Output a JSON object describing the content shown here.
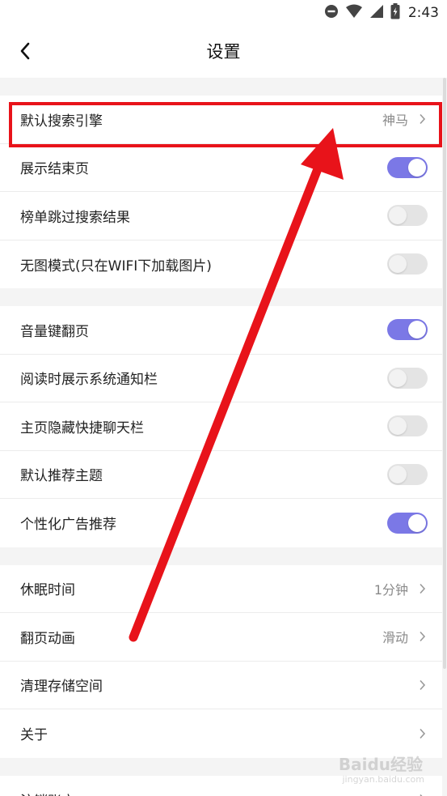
{
  "status_bar": {
    "time": "2:43",
    "icons": [
      "dnd-icon",
      "wifi-icon",
      "signal-icon",
      "battery-icon"
    ]
  },
  "app_bar": {
    "title": "设置",
    "back_icon": "chevron-left-icon"
  },
  "groups": [
    {
      "rows": [
        {
          "label": "默认搜索引擎",
          "type": "value",
          "value": "神马"
        },
        {
          "label": "展示结束页",
          "type": "toggle",
          "on": true
        },
        {
          "label": "榜单跳过搜索结果",
          "type": "toggle",
          "on": false
        },
        {
          "label": "无图模式(只在WIFI下加载图片)",
          "type": "toggle",
          "on": false
        }
      ]
    },
    {
      "rows": [
        {
          "label": "音量键翻页",
          "type": "toggle",
          "on": true
        },
        {
          "label": "阅读时展示系统通知栏",
          "type": "toggle",
          "on": false
        },
        {
          "label": "主页隐藏快捷聊天栏",
          "type": "toggle",
          "on": false
        },
        {
          "label": "默认推荐主题",
          "type": "toggle",
          "on": false
        },
        {
          "label": "个性化广告推荐",
          "type": "toggle",
          "on": true
        }
      ]
    },
    {
      "rows": [
        {
          "label": "休眠时间",
          "type": "value",
          "value": "1分钟"
        },
        {
          "label": "翻页动画",
          "type": "value",
          "value": "滑动"
        },
        {
          "label": "清理存储空间",
          "type": "value",
          "value": ""
        },
        {
          "label": "关于",
          "type": "value",
          "value": ""
        }
      ]
    },
    {
      "rows": [
        {
          "label": "注销账户",
          "type": "value",
          "value": ""
        }
      ]
    }
  ],
  "annotation": {
    "box_color": "#e8131a",
    "arrow_color": "#e8131a"
  },
  "colors": {
    "toggle_on": "#7b78e6",
    "toggle_off": "#e4e4e4"
  },
  "watermark": {
    "brand": "Baidu经验",
    "url": "jingyan.baidu.com"
  }
}
